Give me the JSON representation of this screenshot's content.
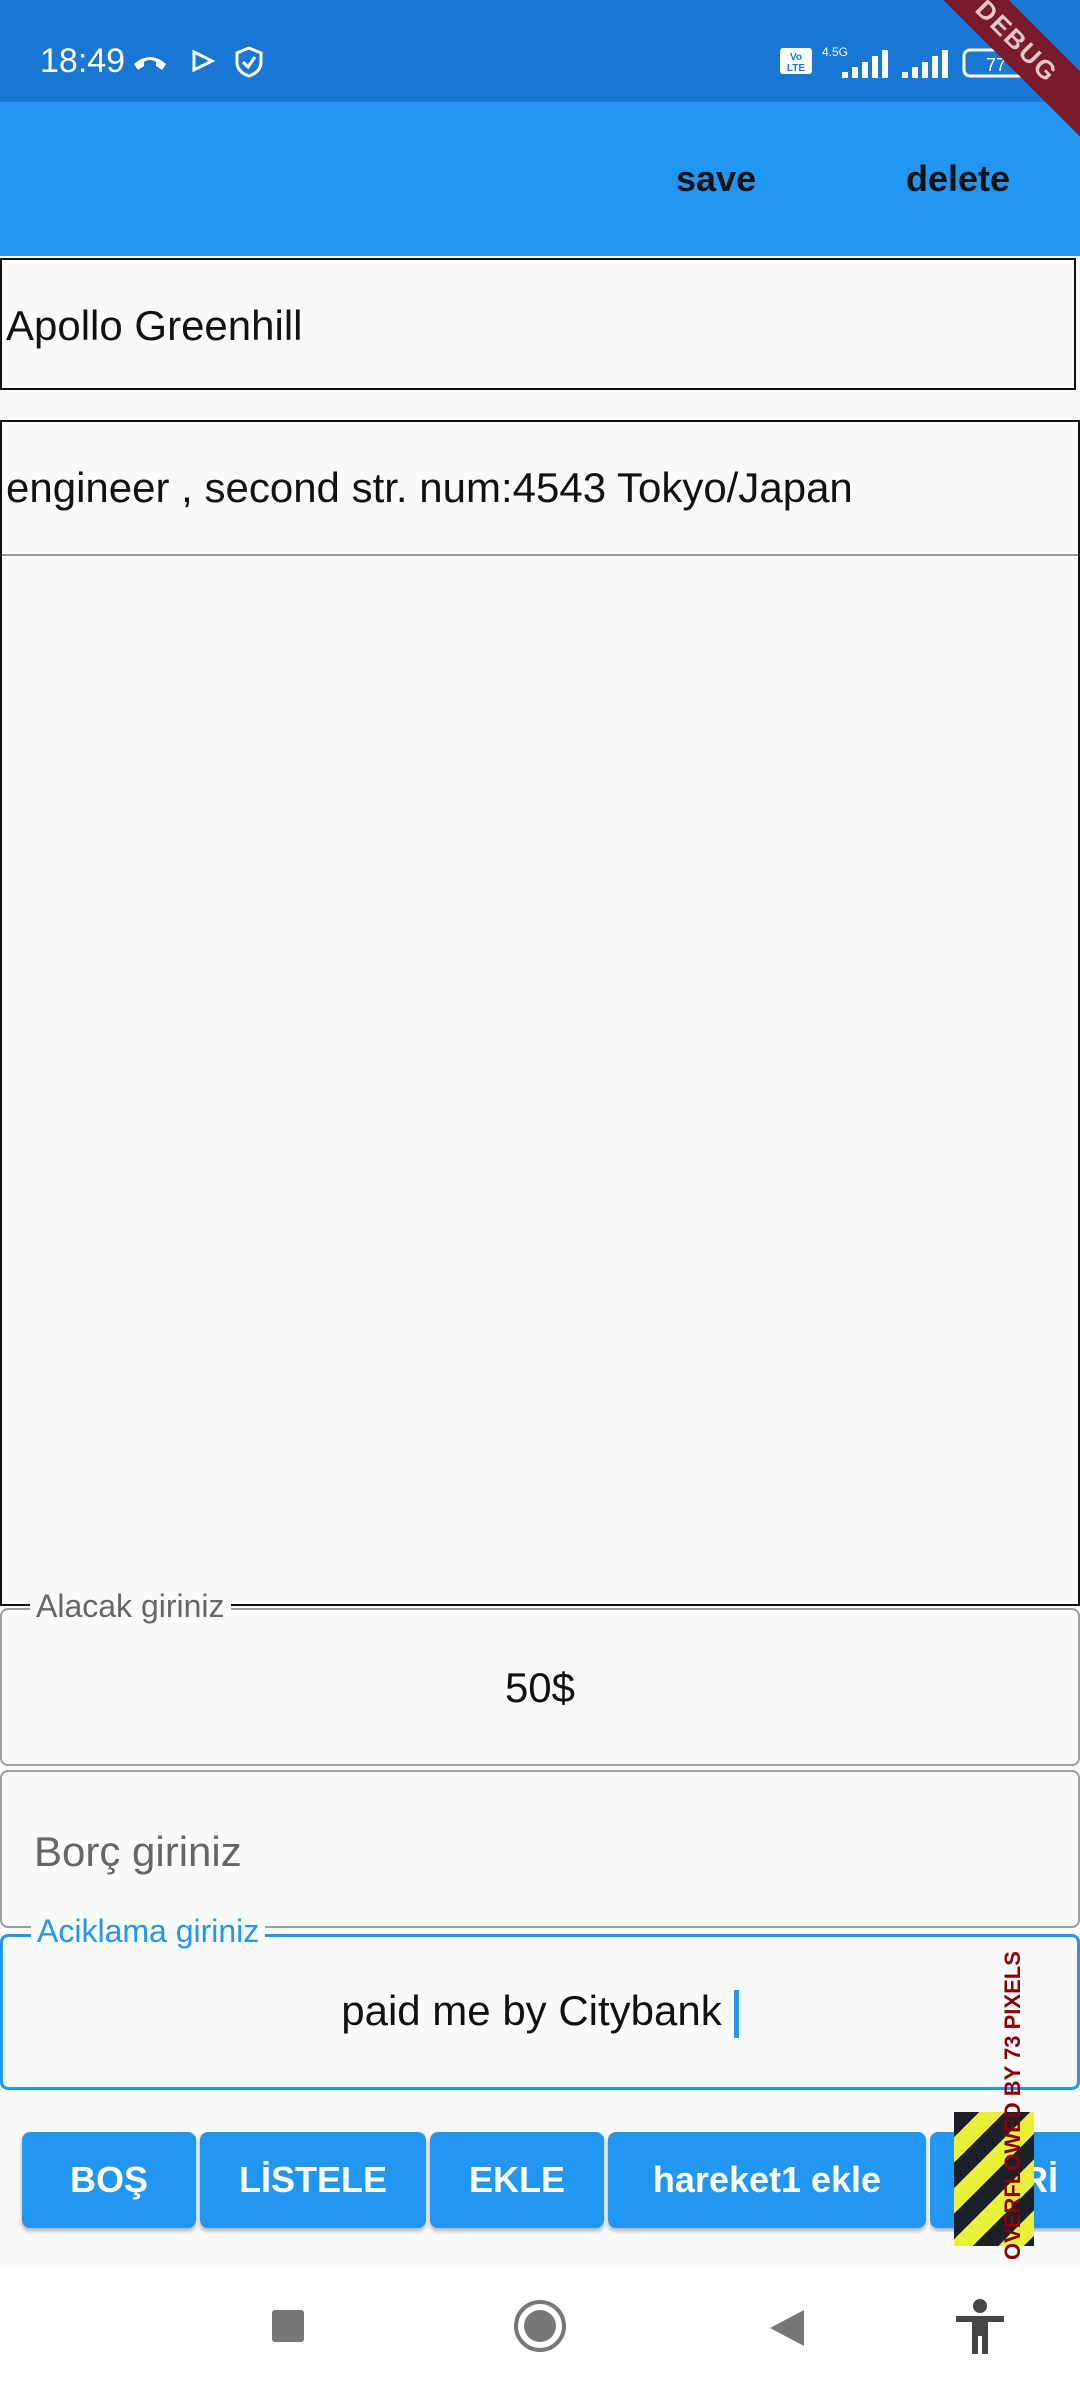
{
  "status_bar": {
    "time": "18:49",
    "battery": "77",
    "icons": [
      "call-forward-icon",
      "play-icon",
      "shield-icon",
      "volte-icon",
      "signal-4g-icon",
      "signal-icon",
      "battery-icon"
    ]
  },
  "app_bar": {
    "save_label": "save",
    "delete_label": "delete",
    "debug_banner": "DEBUG",
    "background": "#2196f3"
  },
  "name_field": {
    "value": "Apollo Greenhill"
  },
  "notes_field": {
    "value": "engineer , second str. num:4543 Tokyo/Japan"
  },
  "alacak_field": {
    "label": "Alacak giriniz",
    "value": "50$"
  },
  "borc_field": {
    "placeholder": "Borç giriniz"
  },
  "aciklama_field": {
    "label": "Aciklama giriniz",
    "value": "paid me by Citybank"
  },
  "buttons": [
    {
      "label": "BOŞ"
    },
    {
      "label": "LİSTELE"
    },
    {
      "label": "EKLE"
    },
    {
      "label": "hareket1 ekle"
    },
    {
      "label": "GERİ"
    }
  ],
  "overflow_warning": "OVERFLOWED BY 73 PIXELS",
  "nav_bar": {
    "icons": [
      "recents-square-icon",
      "home-circle-icon",
      "back-triangle-icon",
      "accessibility-icon"
    ]
  }
}
